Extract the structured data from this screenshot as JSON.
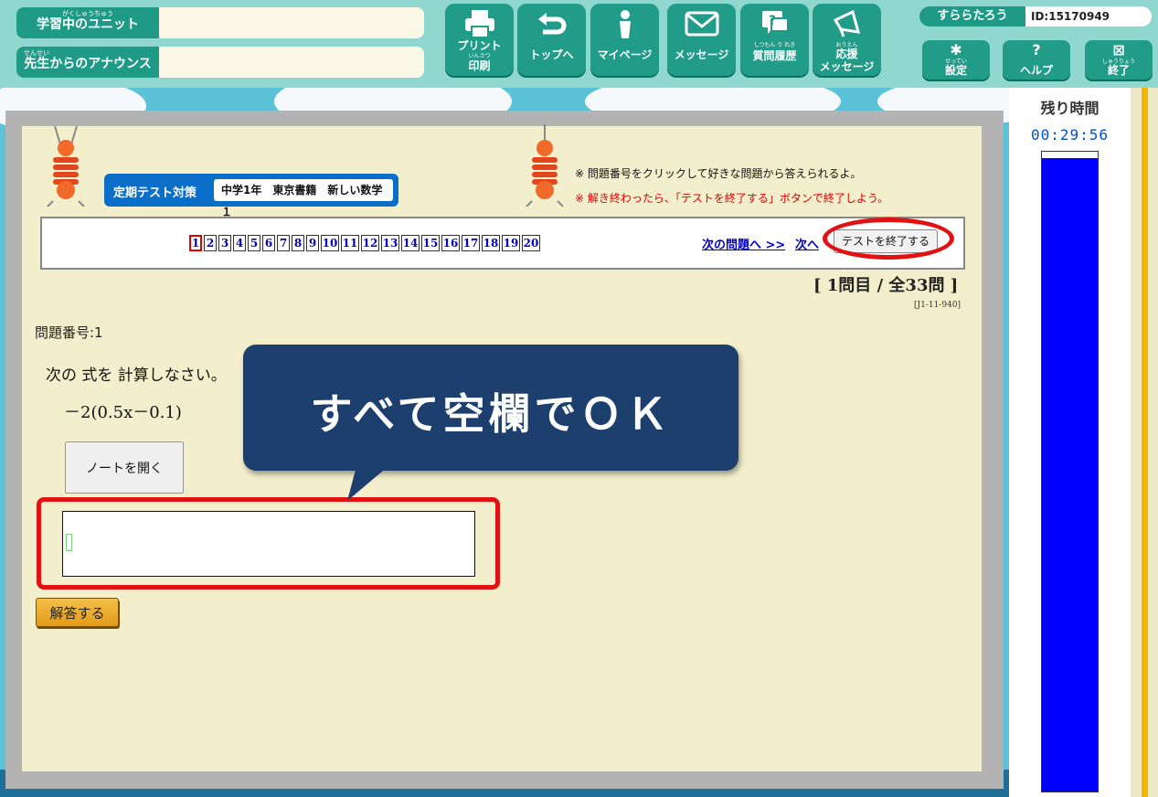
{
  "header": {
    "unit_label": "学習中のユニット",
    "unit_ruby": "がくしゅうちゅう",
    "unit_value": "",
    "announce_label": "先生からのアナウンス",
    "announce_ruby": "せんせい",
    "announce_value": "",
    "nav": {
      "print": {
        "label": "プリント",
        "ruby": "いんさつ",
        "sub": "印刷",
        "icon": "printer-icon"
      },
      "top": {
        "label": "トップへ",
        "icon": "return-arrow-icon"
      },
      "mypage": {
        "label": "マイページ",
        "icon": "person-icon"
      },
      "message": {
        "label": "メッセージ",
        "icon": "envelope-icon"
      },
      "history": {
        "label": "質問履歴",
        "ruby": "しつもん り れき",
        "icon": "question-bubble-icon"
      },
      "support": {
        "label": "応援",
        "ruby": "おうえん",
        "sub": "メッセージ",
        "icon": "megaphone-icon"
      }
    },
    "user": {
      "name": "すららたろう",
      "id": "ID:15170949"
    },
    "settings": {
      "label": "設定",
      "ruby": "せってい",
      "icon": "gear-icon"
    },
    "help": {
      "label": "ヘルプ",
      "icon": "question-icon"
    },
    "exit": {
      "label": "終了",
      "ruby": "しゅうりょう",
      "icon": "close-icon"
    }
  },
  "test": {
    "badge_title": "定期テスト対策",
    "badge_subject": "中学1年　東京書籍　新しい数学１",
    "note_info": "※ 問題番号をクリックして好きな問題から答えられるよ。",
    "note_warning": "※ 解き終わったら、「テストを終了する」ボタンで終了しよう。",
    "question_numbers": [
      "1",
      "2",
      "3",
      "4",
      "5",
      "6",
      "7",
      "8",
      "9",
      "10",
      "11",
      "12",
      "13",
      "14",
      "15",
      "16",
      "17",
      "18",
      "19",
      "20"
    ],
    "active_question": "1",
    "next_question_link": "次の問題へ >>",
    "next_link": "次へ",
    "end_test_button": "テストを終了する",
    "progress": "[ 1問目 / 全33問 ]",
    "code": "[J1-11-940]",
    "question_label": "問題番号:1",
    "question_text": "次の 式を 計算しなさい。",
    "expression": "－2(0.5x－0.1)",
    "note_button": "ノートを開く",
    "answer_value": "",
    "submit_button": "解答する"
  },
  "callout": {
    "text": "すべて空欄でＯＫ"
  },
  "timer": {
    "label": "残り時間",
    "value": "00:29:56",
    "remaining_fraction": 0.99
  },
  "colors": {
    "header_bg": "#8fd7cf",
    "button_green": "#209c88",
    "panel_bg": "#f3eecb",
    "badge_blue": "#0b6fc9",
    "callout_navy": "#1d3f6e",
    "highlight_red": "#e31212",
    "timer_blue": "#0000ff"
  }
}
